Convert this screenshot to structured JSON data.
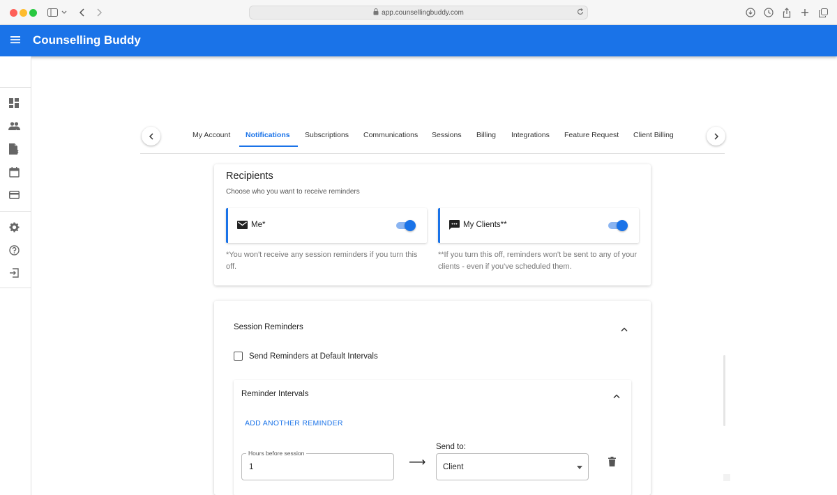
{
  "browser": {
    "url": "app.counsellingbuddy.com"
  },
  "app": {
    "title": "Counselling Buddy"
  },
  "sidebar": {
    "items": [
      {
        "icon": "dashboard-icon"
      },
      {
        "icon": "clients-icon"
      },
      {
        "icon": "notes-icon"
      },
      {
        "icon": "calendar-icon"
      },
      {
        "icon": "billing-icon"
      },
      {
        "icon": "settings-icon"
      },
      {
        "icon": "help-icon"
      },
      {
        "icon": "logout-icon"
      }
    ]
  },
  "tabs": {
    "items": [
      {
        "label": "My Account"
      },
      {
        "label": "Notifications"
      },
      {
        "label": "Subscriptions"
      },
      {
        "label": "Communications"
      },
      {
        "label": "Sessions"
      },
      {
        "label": "Billing"
      },
      {
        "label": "Integrations"
      },
      {
        "label": "Feature Request"
      },
      {
        "label": "Client Billing"
      }
    ],
    "active": "Notifications"
  },
  "recipients": {
    "title": "Recipients",
    "subtitle": "Choose who you want to receive reminders",
    "me": {
      "label": "Me*",
      "enabled": true,
      "note": "*You won't receive any session reminders if you turn this off."
    },
    "clients": {
      "label": "My Clients**",
      "enabled": true,
      "note": "**If you turn this off, reminders won't be sent to any of your clients - even if you've scheduled them."
    }
  },
  "session_reminders": {
    "title": "Session Reminders",
    "default_intervals_label": "Send Reminders at Default Intervals",
    "default_intervals_checked": false,
    "intervals": {
      "title": "Reminder Intervals",
      "add_label": "ADD ANOTHER REMINDER",
      "hours_label": "Hours before session",
      "hours_value": "1",
      "send_to_label": "Send to:",
      "send_to_value": "Client"
    }
  },
  "colors": {
    "primary": "#1a73e8",
    "app_bar": "#1a73e8"
  }
}
